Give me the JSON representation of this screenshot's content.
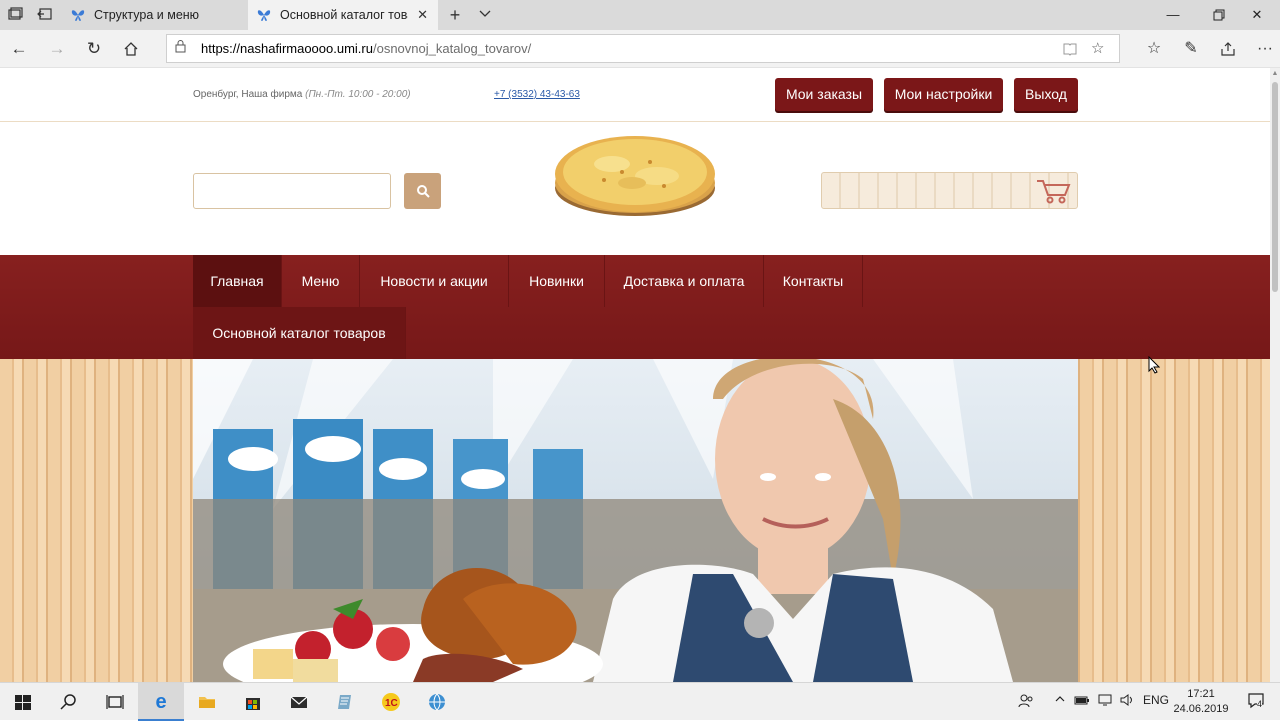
{
  "browser": {
    "tabs": [
      {
        "title": "Структура и меню",
        "active": false
      },
      {
        "title": "Основной каталог това",
        "active": true
      }
    ],
    "url_domain": "https://nashafirmaoooo.umi.ru",
    "url_path": "/osnovnoj_katalog_tovarov/"
  },
  "site": {
    "city": "Оренбург, Наша фирма",
    "hours": "(Пн.-Пт. 10:00 - 20:00)",
    "phone": "+7 (3532) 43-43-63",
    "user_buttons": [
      "Мои заказы",
      "Мои настройки",
      "Выход"
    ],
    "search": {
      "value": "",
      "placeholder": ""
    },
    "menu": [
      {
        "label": "Главная",
        "active": true
      },
      {
        "label": "Меню"
      },
      {
        "label": "Новости и акции"
      },
      {
        "label": "Новинки"
      },
      {
        "label": "Доставка и оплата"
      },
      {
        "label": "Контакты"
      },
      {
        "label": "Основной каталог товаров"
      }
    ],
    "accent_color": "#7b1718"
  },
  "taskbar": {
    "language": "ENG",
    "time": "17:21",
    "date": "24.06.2019",
    "notifications": "4"
  }
}
